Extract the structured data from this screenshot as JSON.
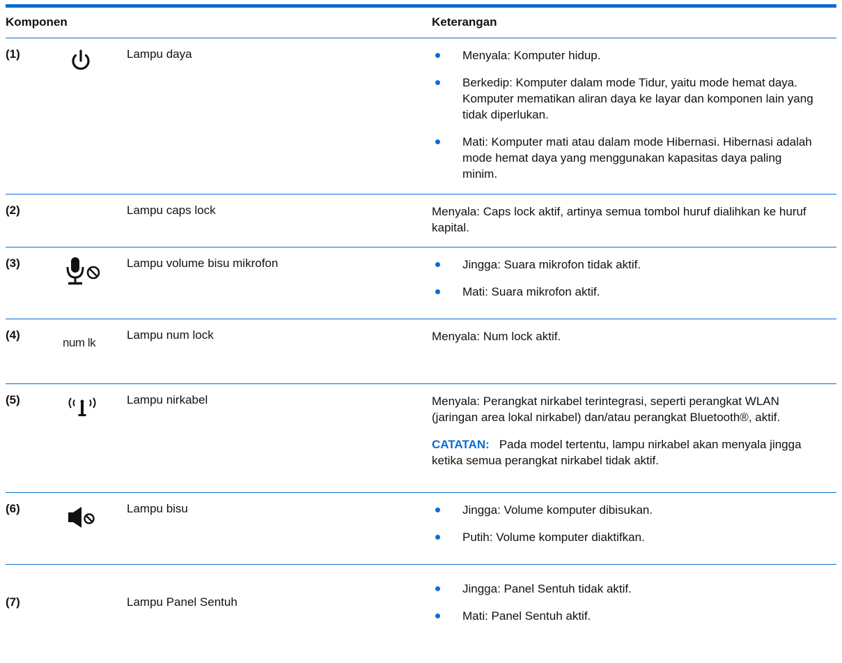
{
  "header": {
    "col_component": "Komponen",
    "col_description": "Keterangan"
  },
  "rows": [
    {
      "number": "(1)",
      "icon": "power-icon",
      "name": "Lampu daya",
      "bullets": [
        "Menyala: Komputer hidup.",
        "Berkedip: Komputer dalam mode Tidur, yaitu mode hemat daya. Komputer mematikan aliran daya ke layar dan komponen lain yang tidak diperlukan.",
        "Mati: Komputer mati atau dalam mode Hibernasi. Hibernasi adalah mode hemat daya yang menggunakan kapasitas daya paling minim."
      ]
    },
    {
      "number": "(2)",
      "icon": "",
      "name": "Lampu caps lock",
      "text": "Menyala: Caps lock aktif, artinya semua tombol huruf dialihkan ke huruf kapital."
    },
    {
      "number": "(3)",
      "icon": "microphone-mute-icon",
      "name": "Lampu volume bisu mikrofon",
      "bullets": [
        "Jingga: Suara mikrofon tidak aktif.",
        "Mati: Suara mikrofon aktif."
      ]
    },
    {
      "number": "(4)",
      "icon": "num-lock-icon",
      "icon_text": "num lk",
      "name": "Lampu num lock",
      "text": "Menyala: Num lock aktif."
    },
    {
      "number": "(5)",
      "icon": "wireless-icon",
      "name": "Lampu nirkabel",
      "text": "Menyala: Perangkat nirkabel terintegrasi, seperti perangkat WLAN (jaringan area lokal nirkabel) dan/atau perangkat Bluetooth®, aktif.",
      "note_label": "CATATAN:",
      "note_text": "Pada model tertentu, lampu nirkabel akan menyala jingga ketika semua perangkat nirkabel tidak aktif."
    },
    {
      "number": "(6)",
      "icon": "speaker-mute-icon",
      "name": "Lampu bisu",
      "bullets": [
        "Jingga: Volume komputer dibisukan.",
        "Putih: Volume komputer diaktifkan."
      ]
    },
    {
      "number": "(7)",
      "icon": "",
      "name": "Lampu Panel Sentuh",
      "bullets": [
        "Jingga: Panel Sentuh tidak aktif.",
        "Mati: Panel Sentuh aktif."
      ]
    }
  ],
  "colors": {
    "accent": "#0b6cd4",
    "text": "#111111"
  }
}
